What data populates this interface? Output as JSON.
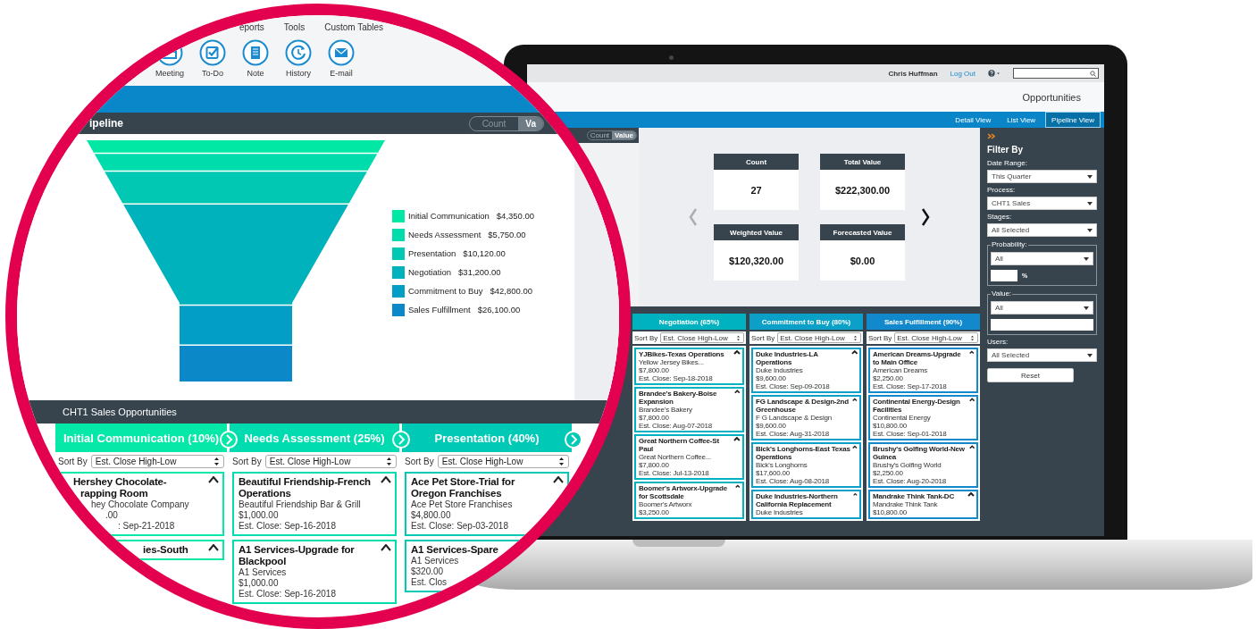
{
  "laptop": {
    "user": "Chris Huffman",
    "logout": "Log Out",
    "page_title": "Opportunities",
    "views": [
      {
        "label": "Detail View",
        "selected": false
      },
      {
        "label": "List View",
        "selected": false
      },
      {
        "label": "Pipeline View",
        "selected": true
      }
    ],
    "chart_toggle": [
      {
        "label": "Count",
        "selected": false
      },
      {
        "label": "Value",
        "selected": true
      }
    ],
    "kpis": [
      {
        "label": "Count",
        "value": "27"
      },
      {
        "label": "Total Value",
        "value": "$222,300.00"
      },
      {
        "label": "Weighted Value",
        "value": "$120,320.00"
      },
      {
        "label": "Forecasted Value",
        "value": "$0.00"
      }
    ],
    "filter": {
      "title": "Filter By",
      "reset": "Reset",
      "fields": [
        {
          "kind": "select",
          "label": "Date Range:",
          "value": "This Quarter"
        },
        {
          "kind": "select",
          "label": "Process:",
          "value": "CHT1 Sales"
        },
        {
          "kind": "select",
          "label": "Stages:",
          "value": "All Selected"
        },
        {
          "kind": "percent",
          "label": "Probability:",
          "value": "All",
          "suffix": "%"
        },
        {
          "kind": "range",
          "label": "Value:",
          "value": "All"
        },
        {
          "kind": "select",
          "label": "Users:",
          "value": "All Selected"
        }
      ]
    },
    "stages": [
      {
        "title": "Negotiation (65%)",
        "color": "#00b2bf",
        "sort_label": "Sort By",
        "sort": "Est. Close High-Low",
        "cards": [
          {
            "title": "YJBikes-Texas Operations",
            "company": "Yellow Jersey Bikes...",
            "amount": "$7,800.00",
            "close": "Est. Close: Sep-18-2018"
          },
          {
            "title": "Brandee's Bakery-Boise Expansion",
            "company": "Brandee's Bakery",
            "amount": "$7,800.00",
            "close": "Est. Close: Aug-07-2018"
          },
          {
            "title": "Great Northern Coffee-St Paul",
            "company": "Great Northern Coffee...",
            "amount": "$7,800.00",
            "close": "Est. Close: Jul-13-2018"
          },
          {
            "title": "Boomer's Artworx-Upgrade for Scottsdale",
            "company": "Boomer's Artworx",
            "amount": "$3,250.00"
          }
        ]
      },
      {
        "title": "Commitment to Buy (80%)",
        "color": "#0aa0c8",
        "sort_label": "Sort By",
        "sort": "Est. Close High-Low",
        "cards": [
          {
            "title": "Duke Industries-LA Operations",
            "company": "Duke Industries",
            "amount": "$9,600.00",
            "close": "Est. Close: Sep-09-2018"
          },
          {
            "title": "FG Landscape & Design-2nd Greenhouse",
            "company": "F G Landscape & Design",
            "amount": "$9,600.00",
            "close": "Est. Close: Aug-31-2018"
          },
          {
            "title": "Bick's Longhorns-East Texas Operations",
            "company": "Bick's Longhorns",
            "amount": "$17,600.00",
            "close": "Est. Close: Aug-08-2018"
          },
          {
            "title": "Duke Industries-Northern California Replacement",
            "company": "Duke Industries"
          }
        ]
      },
      {
        "title": "Sales Fulfillment (90%)",
        "color": "#1289cc",
        "sort_label": "Sort By",
        "sort": "Est. Close High-Low",
        "cards": [
          {
            "title": "American Dreams-Upgrade to Main Office",
            "company": "American Dreams",
            "amount": "$2,250.00",
            "close": "Est. Close: Sep-17-2018"
          },
          {
            "title": "Continental Energy-Design Facilities",
            "company": "Continental Energy",
            "amount": "$10,800.00",
            "close": "Est. Close: Sep-01-2018"
          },
          {
            "title": "Brushy's Golfing World-New Guinea",
            "company": "Brushy's Golfing World",
            "amount": "$2,250.00",
            "close": "Est. Close: Aug-20-2018"
          },
          {
            "title": "Mandrake Think Tank-DC",
            "company": "Mandrake Think Tank",
            "amount": "$10,800.00"
          }
        ]
      }
    ]
  },
  "magnifier": {
    "menu": [
      "eports",
      "Tools",
      "Custom Tables"
    ],
    "toolbar": [
      {
        "kind": "meeting",
        "label": "Meeting"
      },
      {
        "kind": "todo",
        "label": "To-Do"
      },
      {
        "kind": "note",
        "label": "Note"
      },
      {
        "kind": "history",
        "label": "History"
      },
      {
        "kind": "email",
        "label": "E-mail"
      }
    ],
    "pipeline": {
      "title": "ipeline",
      "toggle": [
        {
          "label": "Count",
          "selected": false
        },
        {
          "label": "Va",
          "selected": true
        }
      ],
      "legend": [
        {
          "label": "Initial Communication",
          "value": "$4,350.00",
          "color": "#00e8a4"
        },
        {
          "label": "Needs Assessment",
          "value": "$5,750.00",
          "color": "#00dcac"
        },
        {
          "label": "Presentation",
          "value": "$10,120.00",
          "color": "#00c8b2"
        },
        {
          "label": "Negotiation",
          "value": "$31,200.00",
          "color": "#00b2bc"
        },
        {
          "label": "Commitment to Buy",
          "value": "$42,800.00",
          "color": "#039ec6"
        },
        {
          "label": "Sales Fulfillment",
          "value": "$26,100.00",
          "color": "#0a88c8"
        }
      ]
    },
    "opportunities": {
      "title": "CHT1 Sales Opportunities",
      "stages": [
        {
          "title": "Initial Communication (10%)",
          "color": "#05e8a8",
          "sort_label": "Sort By",
          "sort": "Est. Close High-Low",
          "cards": [
            {
              "title": [
                "Hershey Chocolate-",
                "rapping Room"
              ],
              "company": "hey Chocolate Company",
              "amount": ".00",
              "close": ": Sep-21-2018"
            },
            {
              "title": [
                "ies-South"
              ]
            }
          ]
        },
        {
          "title": "Needs Assessment (25%)",
          "color": "#00dcb0",
          "sort_label": "Sort By",
          "sort": "Est. Close High-Low",
          "cards": [
            {
              "title": [
                "Beautiful Friendship-French",
                "Operations"
              ],
              "company": "Beautiful Friendship Bar & Grill",
              "amount": "$1,000.00",
              "close": "Est. Close: Sep-16-2018"
            },
            {
              "title": [
                "A1 Services-Upgrade for",
                "Blackpool"
              ],
              "company": "A1 Services",
              "amount": "$1,000.00",
              "close": "Est. Close: Sep-16-2018"
            }
          ]
        },
        {
          "title": "Presentation (40%)",
          "color": "#00c9b6",
          "sort_label": "Sort By",
          "sort": "Est. Close High-Low",
          "cards": [
            {
              "title": [
                "Ace Pet Store-Trial for",
                "Oregon Franchises"
              ],
              "company": "Ace Pet Store Franchises",
              "amount": "$4,800.00",
              "close": "Est. Close: Sep-03-2018"
            },
            {
              "title": [
                "A1 Services-Spare"
              ],
              "company": "A1 Services",
              "amount": "$320.00",
              "close": "Est. Clos"
            }
          ]
        }
      ]
    }
  }
}
